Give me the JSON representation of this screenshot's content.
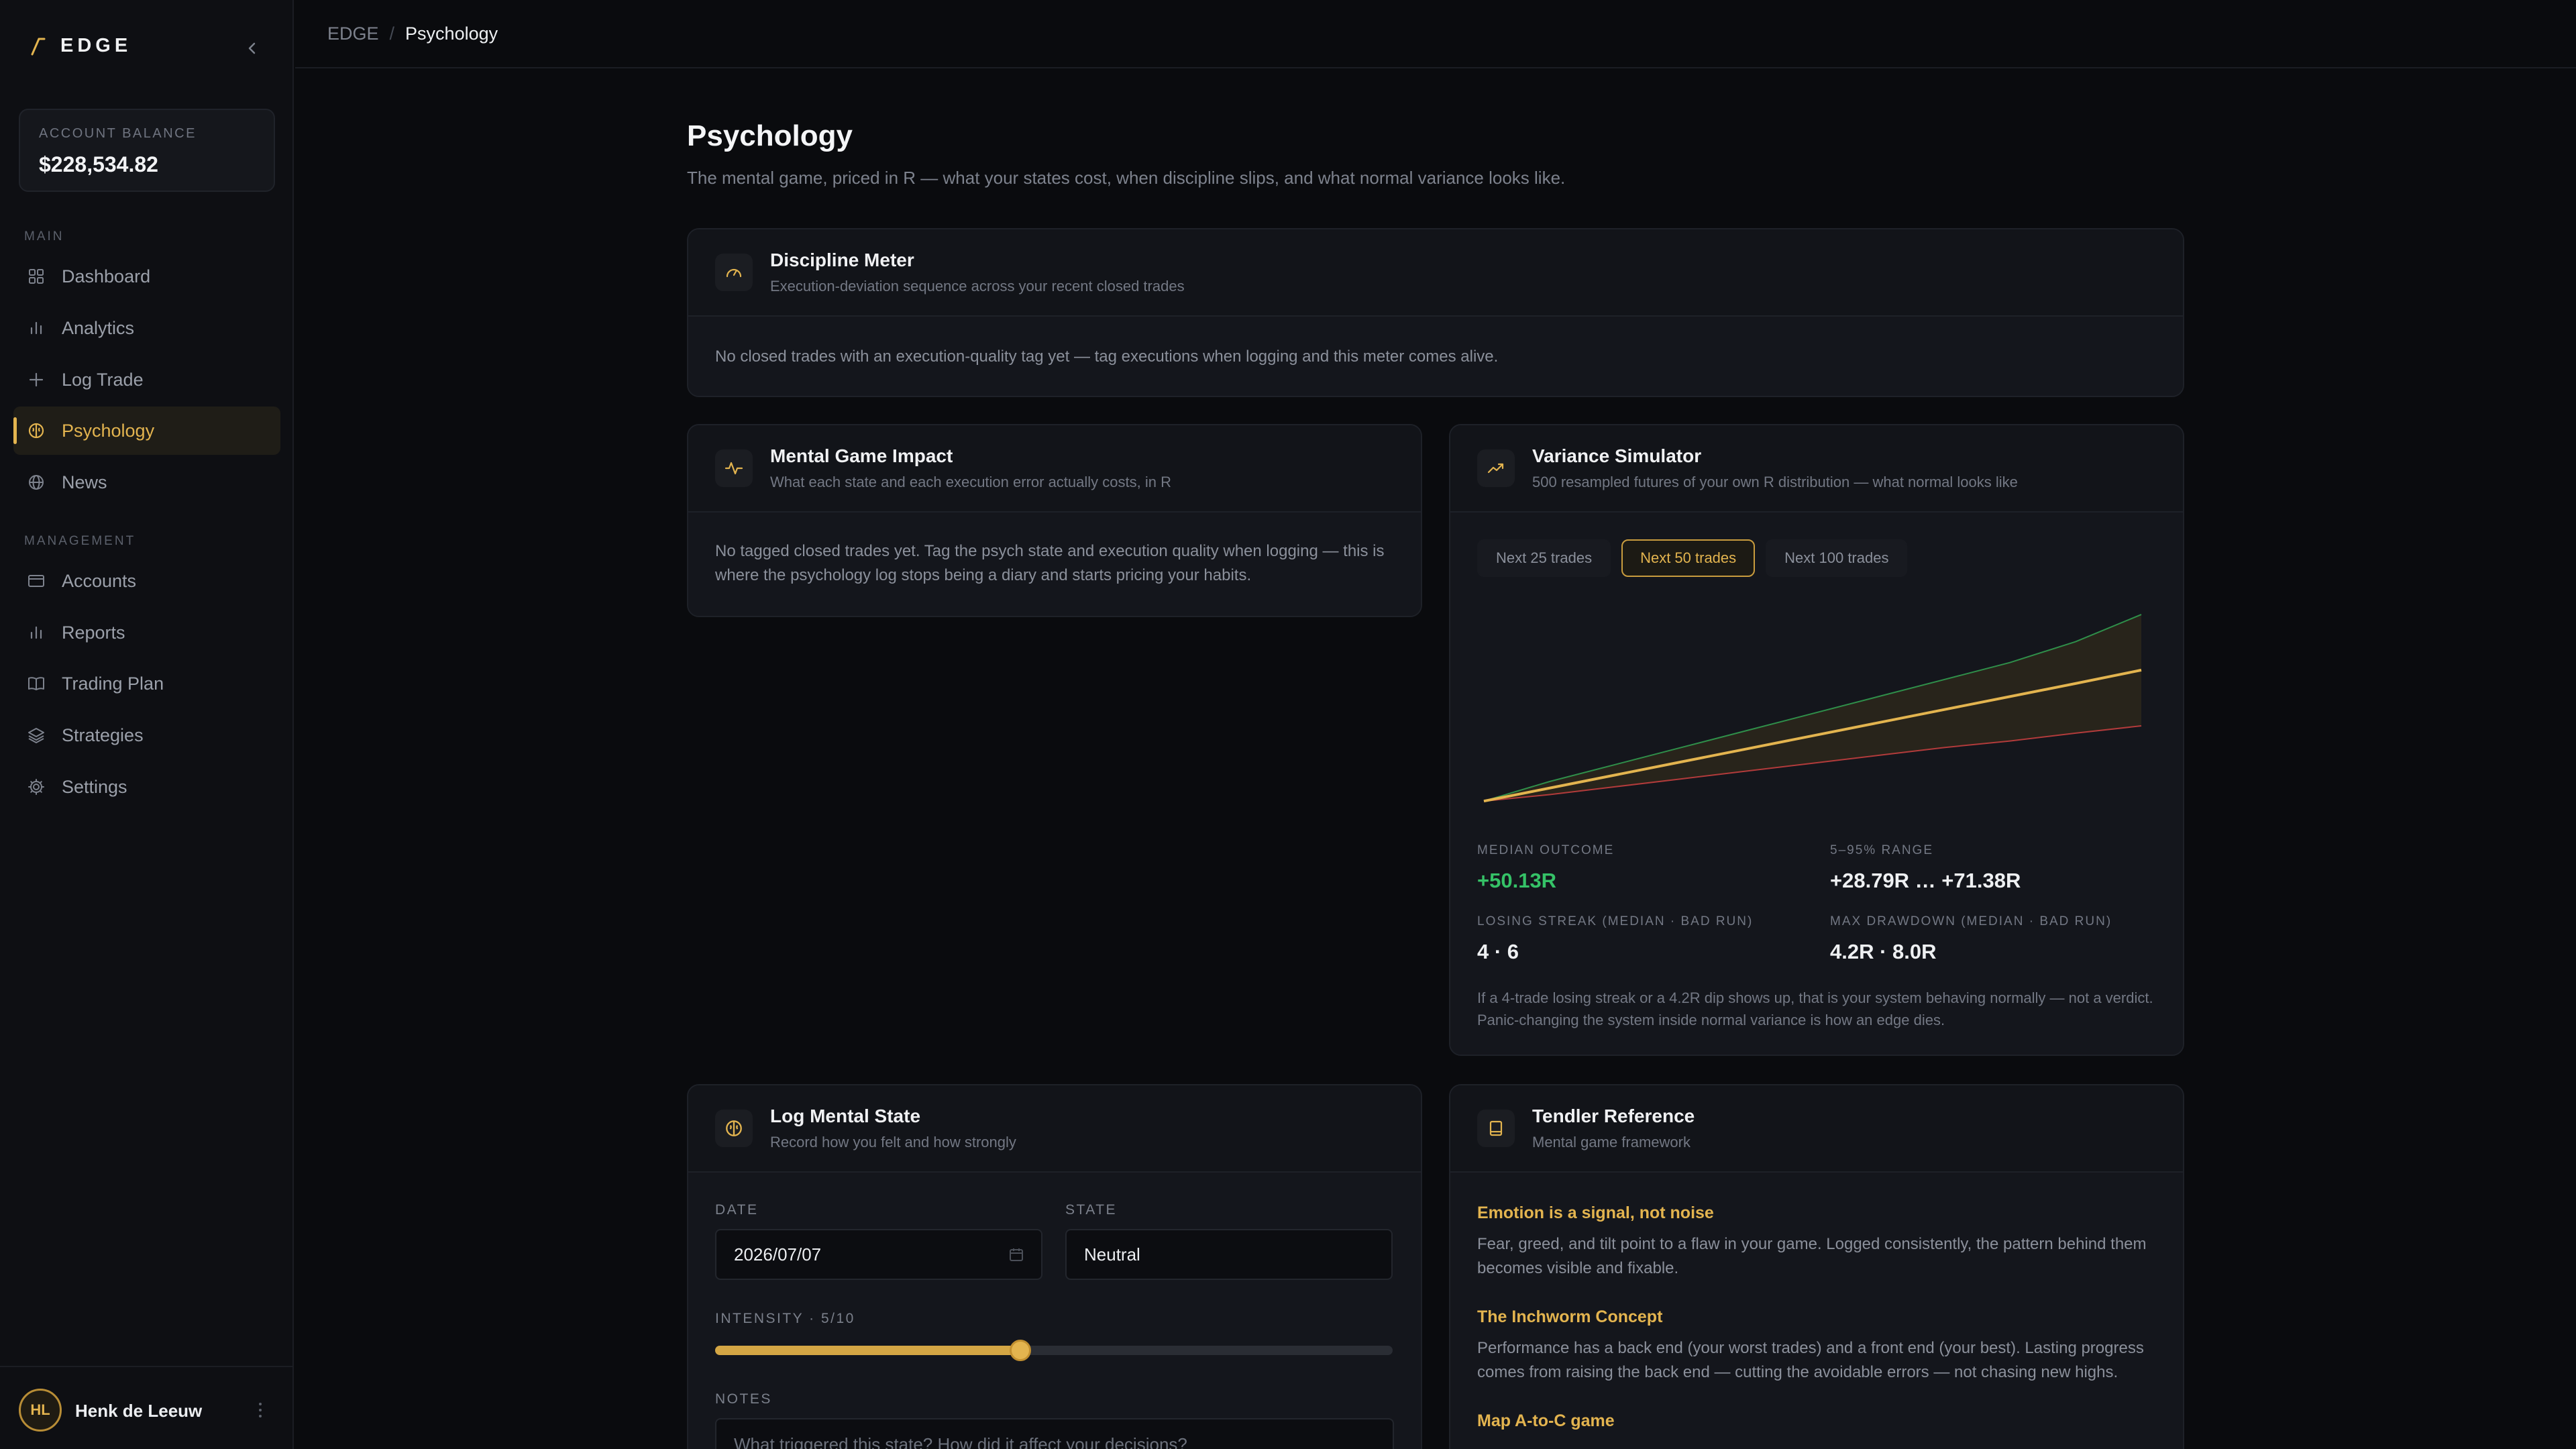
{
  "app": {
    "brand": "EDGE",
    "balance_label": "ACCOUNT BALANCE",
    "balance_value": "$228,534.82"
  },
  "nav": {
    "main_label": "MAIN",
    "management_label": "MANAGEMENT",
    "main_items": [
      {
        "label": "Dashboard",
        "icon": "grid-icon"
      },
      {
        "label": "Analytics",
        "icon": "bar-chart-icon"
      },
      {
        "label": "Log Trade",
        "icon": "plus-icon"
      },
      {
        "label": "Psychology",
        "icon": "brain-icon",
        "active": true
      },
      {
        "label": "News",
        "icon": "globe-icon"
      }
    ],
    "management_items": [
      {
        "label": "Accounts",
        "icon": "card-icon"
      },
      {
        "label": "Reports",
        "icon": "bar-chart-icon"
      },
      {
        "label": "Trading Plan",
        "icon": "book-icon"
      },
      {
        "label": "Strategies",
        "icon": "layers-icon"
      },
      {
        "label": "Settings",
        "icon": "gear-icon"
      }
    ]
  },
  "user": {
    "initials": "HL",
    "name": "Henk de Leeuw"
  },
  "breadcrumb": {
    "root": "EDGE",
    "sep": "/",
    "current": "Psychology"
  },
  "page": {
    "title": "Psychology",
    "subtitle": "The mental game, priced in R — what your states cost, when discipline slips, and what normal variance looks like."
  },
  "discipline": {
    "title": "Discipline Meter",
    "desc": "Execution-deviation sequence across your recent closed trades",
    "empty": "No closed trades with an execution-quality tag yet — tag executions when logging and this meter comes alive."
  },
  "mental": {
    "title": "Mental Game Impact",
    "desc": "What each state and each execution error actually costs, in R",
    "empty": "No tagged closed trades yet. Tag the psych state and execution quality when logging — this is where the psychology log stops being a diary and starts pricing your habits."
  },
  "variance": {
    "title": "Variance Simulator",
    "desc": "500 resampled futures of your own R distribution — what normal looks like",
    "tabs": [
      "Next 25 trades",
      "Next 50 trades",
      "Next 100 trades"
    ],
    "active_tab": 1,
    "stats": [
      {
        "label": "MEDIAN OUTCOME",
        "value": "+50.13R"
      },
      {
        "label": "5–95% RANGE",
        "value": "+28.79R … +71.38R"
      },
      {
        "label": "LOSING STREAK (MEDIAN · BAD RUN)",
        "value": "4 · 6"
      },
      {
        "label": "MAX DRAWDOWN (MEDIAN · BAD RUN)",
        "value": "4.2R · 8.0R"
      }
    ],
    "note": "If a 4-trade losing streak or a 4.2R dip shows up, that is your system behaving normally — not a verdict. Panic-changing the system inside normal variance is how an edge dies.",
    "colors": {
      "median": "#e3b44f",
      "upper": "#2f8f4a",
      "lower": "#b23b3b",
      "band": "#2a261c"
    }
  },
  "chart_data": {
    "type": "area",
    "x": [
      0,
      5,
      10,
      15,
      20,
      25,
      30,
      35,
      40,
      45,
      50
    ],
    "series": [
      {
        "values": [
          0,
          7.5,
          14,
          20.5,
          27,
          33.5,
          40,
          46.5,
          53,
          61,
          71.38
        ]
      },
      {
        "values": [
          0,
          5,
          10,
          15,
          20,
          25,
          30,
          35,
          40,
          45,
          50.13
        ]
      },
      {
        "values": [
          0,
          2.5,
          5.5,
          8.5,
          11.5,
          14.5,
          17.5,
          20.5,
          23,
          26,
          28.79
        ]
      }
    ],
    "ylim": [
      -2,
      75
    ]
  },
  "log": {
    "title": "Log Mental State",
    "desc": "Record how you felt and how strongly",
    "date_label": "DATE",
    "date_value": "2026/07/07",
    "state_label": "STATE",
    "state_value": "Neutral",
    "intensity_label": "INTENSITY · 5/10",
    "intensity": 5,
    "intensity_max": 10,
    "notes_label": "NOTES",
    "notes_placeholder": "What triggered this state? How did it affect your decisions?"
  },
  "tendler": {
    "title": "Tendler Reference",
    "desc": "Mental game framework",
    "items": [
      {
        "title": "Emotion is a signal, not noise",
        "text": "Fear, greed, and tilt point to a flaw in your game. Logged consistently, the pattern behind them becomes visible and fixable."
      },
      {
        "title": "The Inchworm Concept",
        "text": "Performance has a back end (your worst trades) and a front end (your best). Lasting progress comes from raising the back end — cutting the avoidable errors — not chasing new highs."
      },
      {
        "title": "Map A-to-C game",
        "text": ""
      }
    ]
  }
}
